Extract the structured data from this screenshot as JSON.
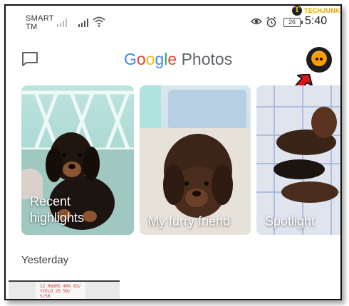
{
  "status_bar": {
    "carrier_line1": "SMART",
    "carrier_line2": "TM",
    "battery": "26",
    "time": "5:40"
  },
  "watermark": {
    "text": "TECHJUNKIE",
    "logo_letter": "T"
  },
  "header": {
    "logo_google": [
      "G",
      "o",
      "o",
      "g",
      "l",
      "e"
    ],
    "logo_suffix": "Photos",
    "left_icon": "message-icon",
    "avatar_icon": "garfield-avatar"
  },
  "cards": [
    {
      "line1": "Recent",
      "line2": "highlights"
    },
    {
      "line1": "My furry friend"
    },
    {
      "line1": "Spotlight"
    }
  ],
  "section": {
    "title": "Yesterday"
  },
  "thumbnail_text": [
    "12 HOURS 40% 83/",
    "YIELD 25  50/",
    "5/50"
  ],
  "colors": {
    "google_blue": "#4285f4",
    "google_red": "#ea4335",
    "google_yellow": "#fbbc05",
    "google_green": "#34a853",
    "annotation_arrow": "#e0141e"
  }
}
